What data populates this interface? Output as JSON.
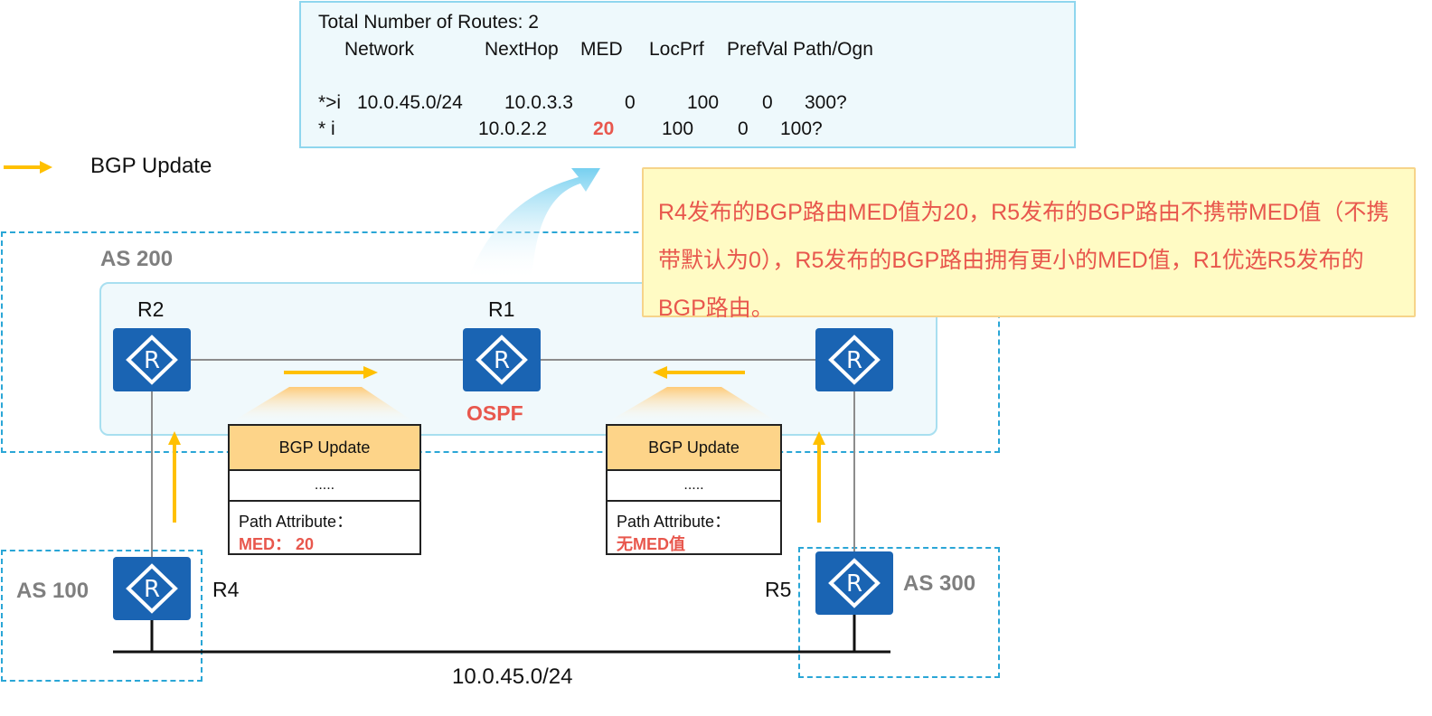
{
  "route_table": {
    "total_line": "Total Number of Routes: 2",
    "headers": {
      "network": "Network",
      "nexthop": "NextHop",
      "med": "MED",
      "locprf": "LocPrf",
      "prefval": "PrefVal Path/Ogn"
    },
    "rows": [
      {
        "status": "*>i",
        "network": "10.0.45.0/24",
        "nexthop": "10.0.3.3",
        "med": "0",
        "locprf": "100",
        "prefval": "0",
        "path": "300?"
      },
      {
        "status": "* i",
        "network": "",
        "nexthop": "10.0.2.2",
        "med": "20",
        "locprf": "100",
        "prefval": "0",
        "path": "100?"
      }
    ]
  },
  "legend": {
    "label": "BGP Update",
    "color": "#ffc000"
  },
  "as_labels": {
    "as200": "AS 200",
    "as100": "AS 100",
    "as300": "AS 300"
  },
  "routers": {
    "r1": "R1",
    "r2": "R2",
    "r4": "R4",
    "r5": "R5"
  },
  "ospf_label": "OSPF",
  "update_left": {
    "header": "BGP Update",
    "dots": ".....",
    "attr": "Path Attribute：",
    "value": "MED： 20"
  },
  "update_right": {
    "header": "BGP Update",
    "dots": ".....",
    "attr": "Path Attribute：",
    "value": "无MED值"
  },
  "note": "R4发布的BGP路由MED值为20，R5发布的BGP路由不携带MED值（不携带默认为0），R5发布的BGP路由拥有更小的MED值，R1优选R5发布的BGP路由。",
  "network_label": "10.0.45.0/24",
  "colors": {
    "router": "#1a64b3",
    "arrow": "#ffc000",
    "accent_red": "#e8574d",
    "dash_blue": "#2aa6d6"
  }
}
